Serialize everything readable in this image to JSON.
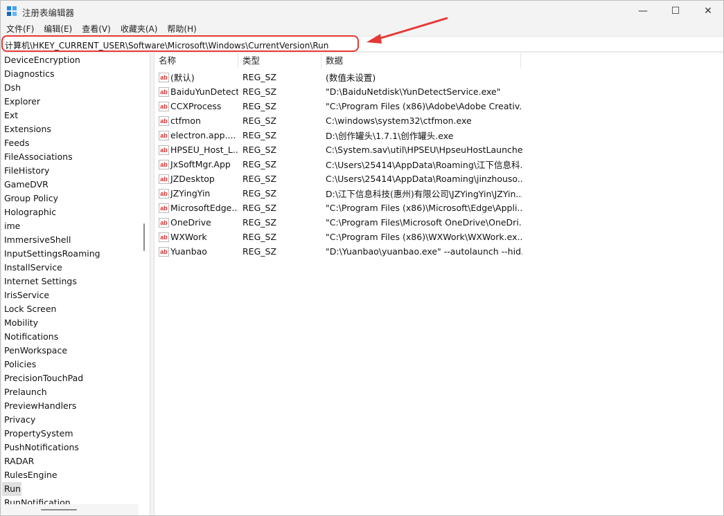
{
  "window": {
    "title": "注册表编辑器",
    "controls": {
      "minimize": "—",
      "maximize": "☐",
      "close": "✕"
    }
  },
  "menu": [
    "文件(F)",
    "编辑(E)",
    "查看(V)",
    "收藏夹(A)",
    "帮助(H)"
  ],
  "address": "计算机\\HKEY_CURRENT_USER\\Software\\Microsoft\\Windows\\CurrentVersion\\Run",
  "annotation_color": "#e53935",
  "tree": {
    "items": [
      "DeviceEncryption",
      "Diagnostics",
      "Dsh",
      "Explorer",
      "Ext",
      "Extensions",
      "Feeds",
      "FileAssociations",
      "FileHistory",
      "GameDVR",
      "Group Policy",
      "Holographic",
      "ime",
      "ImmersiveShell",
      "InputSettingsRoaming",
      "InstallService",
      "Internet Settings",
      "IrisService",
      "Lock Screen",
      "Mobility",
      "Notifications",
      "PenWorkspace",
      "Policies",
      "PrecisionTouchPad",
      "Prelaunch",
      "PreviewHandlers",
      "Privacy",
      "PropertySystem",
      "PushNotifications",
      "RADAR",
      "RulesEngine",
      "Run",
      "RunNotification"
    ],
    "selected": "Run"
  },
  "list": {
    "columns": [
      "名称",
      "类型",
      "数据"
    ],
    "value_icon": "string-value-icon",
    "rows": [
      {
        "name": "(默认)",
        "type": "REG_SZ",
        "data": "(数值未设置)"
      },
      {
        "name": "BaiduYunDetect",
        "type": "REG_SZ",
        "data": "\"D:\\BaiduNetdisk\\YunDetectService.exe\""
      },
      {
        "name": "CCXProcess",
        "type": "REG_SZ",
        "data": "\"C:\\Program Files (x86)\\Adobe\\Adobe Creativ..."
      },
      {
        "name": "ctfmon",
        "type": "REG_SZ",
        "data": "C:\\windows\\system32\\ctfmon.exe"
      },
      {
        "name": "electron.app....",
        "type": "REG_SZ",
        "data": "D:\\创作罐头\\1.7.1\\创作罐头.exe"
      },
      {
        "name": "HPSEU_Host_L...",
        "type": "REG_SZ",
        "data": "C:\\System.sav\\util\\HPSEU\\HpseuHostLauncher..."
      },
      {
        "name": "JxSoftMgr.App",
        "type": "REG_SZ",
        "data": "C:\\Users\\25414\\AppData\\Roaming\\江下信息科..."
      },
      {
        "name": "JZDesktop",
        "type": "REG_SZ",
        "data": "C:\\Users\\25414\\AppData\\Roaming\\jinzhouso..."
      },
      {
        "name": "JZYingYin",
        "type": "REG_SZ",
        "data": "D:\\江下信息科技(惠州)有限公司\\JZYingYin\\JZYin..."
      },
      {
        "name": "MicrosoftEdge...",
        "type": "REG_SZ",
        "data": "\"C:\\Program Files (x86)\\Microsoft\\Edge\\Appli..."
      },
      {
        "name": "OneDrive",
        "type": "REG_SZ",
        "data": "\"C:\\Program Files\\Microsoft OneDrive\\OneDri..."
      },
      {
        "name": "WXWork",
        "type": "REG_SZ",
        "data": "\"C:\\Program Files (x86)\\WXWork\\WXWork.ex..."
      },
      {
        "name": "Yuanbao",
        "type": "REG_SZ",
        "data": "\"D:\\Yuanbao\\yuanbao.exe\" --autolaunch --hid..."
      }
    ]
  }
}
